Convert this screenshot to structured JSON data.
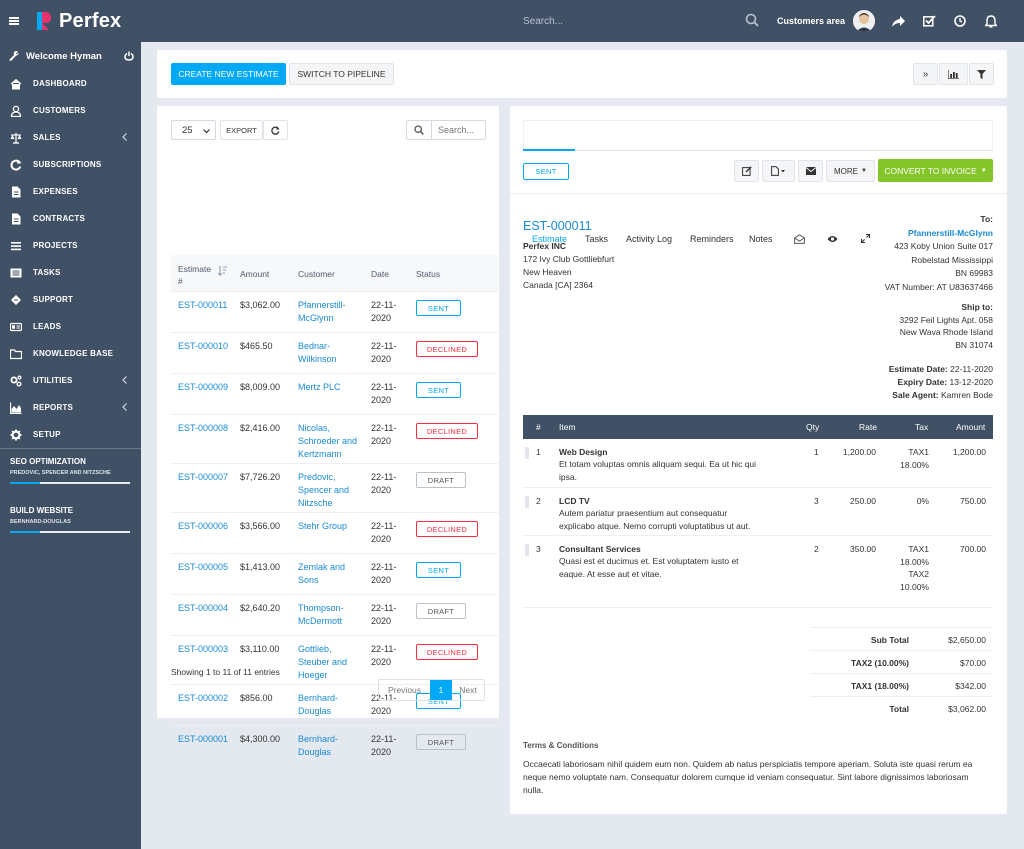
{
  "app": {
    "name": "Perfex"
  },
  "topbar": {
    "search_placeholder": "Search...",
    "customers_area": "Customers area"
  },
  "sidebar": {
    "welcome": "Welcome Hyman",
    "items": [
      {
        "label": "DASHBOARD",
        "icon": "home-icon"
      },
      {
        "label": "CUSTOMERS",
        "icon": "user-icon"
      },
      {
        "label": "SALES",
        "icon": "scale-icon",
        "has_children": true
      },
      {
        "label": "SUBSCRIPTIONS",
        "icon": "refresh-icon"
      },
      {
        "label": "EXPENSES",
        "icon": "file-icon"
      },
      {
        "label": "CONTRACTS",
        "icon": "file-icon"
      },
      {
        "label": "PROJECTS",
        "icon": "bars-icon"
      },
      {
        "label": "TASKS",
        "icon": "tasks-icon"
      },
      {
        "label": "SUPPORT",
        "icon": "ticket-icon"
      },
      {
        "label": "LEADS",
        "icon": "leads-icon"
      },
      {
        "label": "KNOWLEDGE BASE",
        "icon": "folder-icon"
      },
      {
        "label": "UTILITIES",
        "icon": "cogs-icon",
        "has_children": true
      },
      {
        "label": "REPORTS",
        "icon": "area-chart-icon",
        "has_children": true
      },
      {
        "label": "SETUP",
        "icon": "gear-icon"
      }
    ],
    "projects": [
      {
        "title": "SEO OPTIMIZATION",
        "client": "PREDOVIC, SPENCER AND NITZSCHE",
        "progress": 0.25
      },
      {
        "title": "BUILD WEBSITE",
        "client": "BERNHARD-DOUGLAS",
        "progress": 0.25
      }
    ]
  },
  "toolbar": {
    "create_label": "CREATE NEW ESTIMATE",
    "pipeline_label": "SWITCH TO PIPELINE"
  },
  "list": {
    "page_size": "25",
    "export_label": "EXPORT",
    "search_placeholder": "Search...",
    "columns": {
      "estimate_1": "Estimate",
      "estimate_2": "#",
      "amount": "Amount",
      "customer": "Customer",
      "date": "Date",
      "status": "Status"
    },
    "rows": [
      {
        "id": "EST-000011",
        "amount": "$3,062.00",
        "customer": [
          "Pfannerstill-",
          "McGlynn"
        ],
        "date": [
          "22-11-",
          "2020"
        ],
        "status": "SENT"
      },
      {
        "id": "EST-000010",
        "amount": "$465.50",
        "customer": [
          "Bednar-",
          "Wilkinson"
        ],
        "date": [
          "22-11-",
          "2020"
        ],
        "status": "DECLINED"
      },
      {
        "id": "EST-000009",
        "amount": "$8,009.00",
        "customer": [
          "Mertz PLC"
        ],
        "date": [
          "22-11-",
          "2020"
        ],
        "status": "SENT"
      },
      {
        "id": "EST-000008",
        "amount": "$2,416.00",
        "customer": [
          "Nicolas,",
          "Schroeder and",
          "Kertzmann"
        ],
        "date": [
          "22-11-",
          "2020"
        ],
        "status": "DECLINED"
      },
      {
        "id": "EST-000007",
        "amount": "$7,726.20",
        "customer": [
          "Predovic,",
          "Spencer and",
          "Nitzsche"
        ],
        "date": [
          "22-11-",
          "2020"
        ],
        "status": "DRAFT"
      },
      {
        "id": "EST-000006",
        "amount": "$3,566.00",
        "customer": [
          "Stehr Group"
        ],
        "date": [
          "22-11-",
          "2020"
        ],
        "status": "DECLINED"
      },
      {
        "id": "EST-000005",
        "amount": "$1,413.00",
        "customer": [
          "Zemlak and",
          "Sons"
        ],
        "date": [
          "22-11-",
          "2020"
        ],
        "status": "SENT"
      },
      {
        "id": "EST-000004",
        "amount": "$2,640.20",
        "customer": [
          "Thompson-",
          "McDermott"
        ],
        "date": [
          "22-11-",
          "2020"
        ],
        "status": "DRAFT"
      },
      {
        "id": "EST-000003",
        "amount": "$3,110.00",
        "customer": [
          "Gottlieb,",
          "Steuber and",
          "Hoeger"
        ],
        "date": [
          "22-11-",
          "2020"
        ],
        "status": "DECLINED"
      },
      {
        "id": "EST-000002",
        "amount": "$856.00",
        "customer": [
          "Bernhard-",
          "Douglas"
        ],
        "date": [
          "22-11-",
          "2020"
        ],
        "status": "SENT"
      },
      {
        "id": "EST-000001",
        "amount": "$4,300.00",
        "customer": [
          "Bernhard-",
          "Douglas"
        ],
        "date": [
          "22-11-",
          "2020"
        ],
        "status": "DRAFT"
      }
    ],
    "footer": "Showing 1 to 11 of 11 entries",
    "pagination": {
      "prev": "Previous",
      "page": "1",
      "next": "Next"
    }
  },
  "detail": {
    "tabs": [
      "Estimate",
      "Tasks",
      "Activity Log",
      "Reminders",
      "Notes"
    ],
    "status": "SENT",
    "more_label": "MORE",
    "convert_label": "CONVERT TO INVOICE",
    "number": "EST-000011",
    "from": [
      "Perfex INC",
      "172 Ivy Club Gottliebfurt",
      "New Heaven",
      "Canada [CA] 2364"
    ],
    "to_label": "To:",
    "to_name": "Pfannerstill-McGlynn",
    "to_lines": [
      "423 Koby Union Suite 017",
      "Robelstad Mississippi",
      "BN 69983",
      "VAT Number: AT U83637466"
    ],
    "ship_label": "Ship to:",
    "ship_lines": [
      "3292 Feil Lights Apt. 058",
      "New Wava Rhode Island",
      "BN 31074"
    ],
    "dates": [
      {
        "label": "Estimate Date:",
        "value": "22-11-2020"
      },
      {
        "label": "Expiry Date:",
        "value": "13-12-2020"
      },
      {
        "label": "Sale Agent:",
        "value": "Kamren Bode"
      }
    ],
    "table_headers": {
      "num": "#",
      "item": "Item",
      "qty": "Qty",
      "rate": "Rate",
      "tax": "Tax",
      "amount": "Amount"
    },
    "items": [
      {
        "n": "1",
        "name": "Web Design",
        "desc": [
          "Et totam voluptas omnis aliquam sequi. Ea ut hic qui",
          "ipsa."
        ],
        "qty": "1",
        "rate": "1,200.00",
        "tax": [
          "TAX1",
          "18.00%"
        ],
        "amount": "1,200.00"
      },
      {
        "n": "2",
        "name": "LCD TV",
        "desc": [
          "Autem pariatur praesentium aut consequatur",
          "explicabo atque. Nemo corrupti voluptatibus ut aut."
        ],
        "qty": "3",
        "rate": "250.00",
        "tax": [
          "0%"
        ],
        "amount": "750.00"
      },
      {
        "n": "3",
        "name": "Consultant Services",
        "desc": [
          "Quasi est et ducimus et. Est voluptatem iusto et",
          "eaque. At esse aut et vitae."
        ],
        "qty": "2",
        "rate": "350.00",
        "tax": [
          "TAX1",
          "18.00%",
          "TAX2",
          "10.00%"
        ],
        "amount": "700.00"
      }
    ],
    "summary": [
      {
        "label": "Sub Total",
        "value": "$2,650.00"
      },
      {
        "label": "TAX2 (10.00%)",
        "value": "$70.00"
      },
      {
        "label": "TAX1 (18.00%)",
        "value": "$342.00"
      },
      {
        "label": "Total",
        "value": "$3,062.00"
      }
    ],
    "terms_label": "Terms & Conditions",
    "terms_lines": [
      "Occaecati laboriosam nihil quidem eum non. Quidem ab natus perspiciatis tempore aperiam. Soluta iste quasi rerum ea",
      "neque nemo voluptate nam. Consequatur dolorem cumque id veniam consequatur. Sint labore dignissimos laboriosam",
      "nulla."
    ]
  },
  "colors": {
    "topbar": "#415165",
    "accent": "#03a9f4",
    "success": "#84c529",
    "danger": "#fc2d42"
  }
}
